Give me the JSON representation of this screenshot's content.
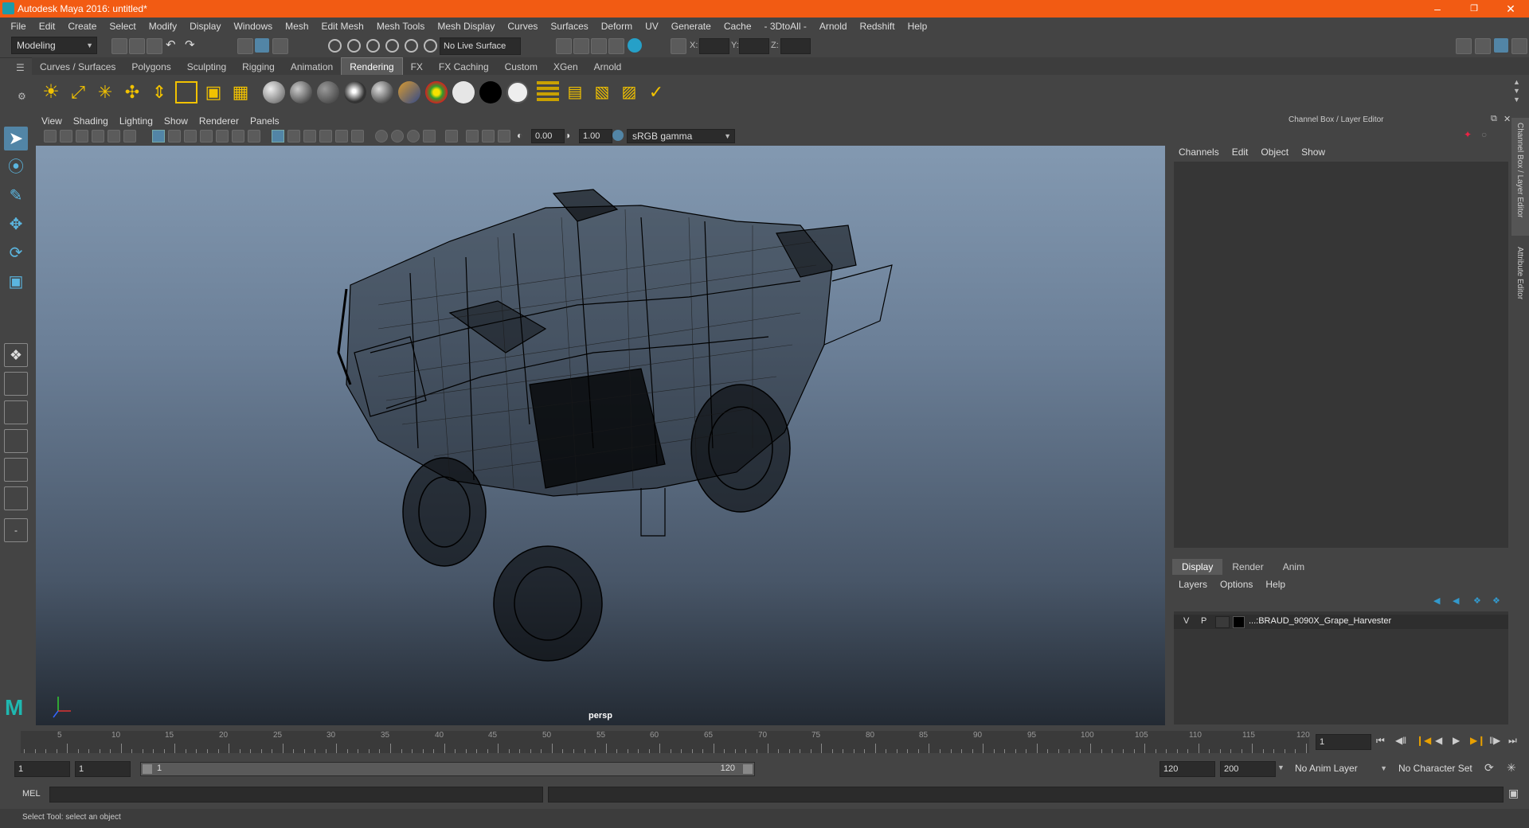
{
  "window": {
    "title": "Autodesk Maya 2016: untitled*"
  },
  "menu": [
    "File",
    "Edit",
    "Create",
    "Select",
    "Modify",
    "Display",
    "Windows",
    "Mesh",
    "Edit Mesh",
    "Mesh Tools",
    "Mesh Display",
    "Curves",
    "Surfaces",
    "Deform",
    "UV",
    "Generate",
    "Cache",
    "- 3DtoAll -",
    "Arnold",
    "Redshift",
    "Help"
  ],
  "status": {
    "mode": "Modeling",
    "live_surface": "No Live Surface",
    "x_label": "X:",
    "y_label": "Y:",
    "z_label": "Z:"
  },
  "shelf_tabs": [
    {
      "label": "Curves / Surfaces",
      "active": false
    },
    {
      "label": "Polygons",
      "active": false
    },
    {
      "label": "Sculpting",
      "active": false
    },
    {
      "label": "Rigging",
      "active": false
    },
    {
      "label": "Animation",
      "active": false
    },
    {
      "label": "Rendering",
      "active": true
    },
    {
      "label": "FX",
      "active": false
    },
    {
      "label": "FX Caching",
      "active": false
    },
    {
      "label": "Custom",
      "active": false
    },
    {
      "label": "XGen",
      "active": false
    },
    {
      "label": "Arnold",
      "active": false
    }
  ],
  "viewport": {
    "menu": [
      "View",
      "Shading",
      "Lighting",
      "Show",
      "Renderer",
      "Panels"
    ],
    "exposure": "0.00",
    "gamma": "1.00",
    "color_space": "sRGB gamma",
    "camera_label": "persp"
  },
  "channel_box": {
    "title": "Channel Box / Layer Editor",
    "menu": [
      "Channels",
      "Edit",
      "Object",
      "Show"
    ]
  },
  "layer_editor": {
    "tabs": [
      {
        "label": "Display",
        "active": true
      },
      {
        "label": "Render",
        "active": false
      },
      {
        "label": "Anim",
        "active": false
      }
    ],
    "menu": [
      "Layers",
      "Options",
      "Help"
    ],
    "layer": {
      "v": "V",
      "p": "P",
      "name": "...:BRAUD_9090X_Grape_Harvester"
    }
  },
  "side_tabs": {
    "channel_box": "Channel Box / Layer Editor",
    "attribute_editor": "Attribute Editor"
  },
  "timeline": {
    "ticks": [
      "5",
      "10",
      "15",
      "20",
      "25",
      "30",
      "35",
      "40",
      "45",
      "50",
      "55",
      "60",
      "65",
      "70",
      "75",
      "80",
      "85",
      "90",
      "95",
      "100",
      "105",
      "110",
      "115",
      "120"
    ],
    "start_label": "1",
    "current_frame": "1"
  },
  "range": {
    "start": "1",
    "playback_start": "1",
    "slider_start": "1",
    "slider_end": "120",
    "playback_end": "120",
    "end": "200",
    "anim_layer": "No Anim Layer",
    "character_set": "No Character Set"
  },
  "command_line": {
    "label": "MEL"
  },
  "help_line": {
    "text": "Select Tool: select an object"
  },
  "colors": {
    "title_bar": "#f25b13",
    "accent": "#5285a6"
  }
}
